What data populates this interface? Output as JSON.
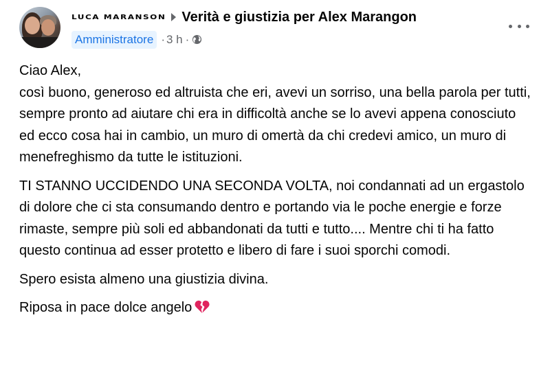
{
  "post": {
    "author": "LUCA MARANSON",
    "group": "Verità e giustizia per Alex Marangon",
    "badge": "Amministratore",
    "separator": "·",
    "time": "3 h",
    "dot": "·",
    "icons": {
      "arrow": "caret-right-icon",
      "audience": "globe-icon",
      "menu": "more-options-icon",
      "emoji": "broken-heart-icon"
    },
    "colors": {
      "badge_bg": "#e7f3ff",
      "badge_text": "#1b74e4",
      "meta_text": "#65676b",
      "broken_heart": "#e0245e"
    },
    "paragraphs": [
      "Ciao Alex,\ncosì buono, generoso ed altruista che eri, avevi un sorriso, una bella parola per tutti, sempre pronto ad aiutare chi era in difficoltà anche se lo avevi appena conosciuto ed ecco cosa hai in cambio, un muro di omertà da chi credevi amico, un muro di menefreghismo da tutte le istituzioni.",
      "TI STANNO UCCIDENDO UNA SECONDA VOLTA, noi condannati ad un ergastolo di dolore che ci sta consumando dentro e portando via le poche energie e forze rimaste, sempre più soli ed abbandonati da tutti e tutto.... Mentre chi ti ha fatto questo continua ad esser protetto e libero di fare i suoi sporchi comodi.",
      "Spero esista almeno una giustizia divina.",
      "Riposa in pace dolce angelo"
    ]
  }
}
